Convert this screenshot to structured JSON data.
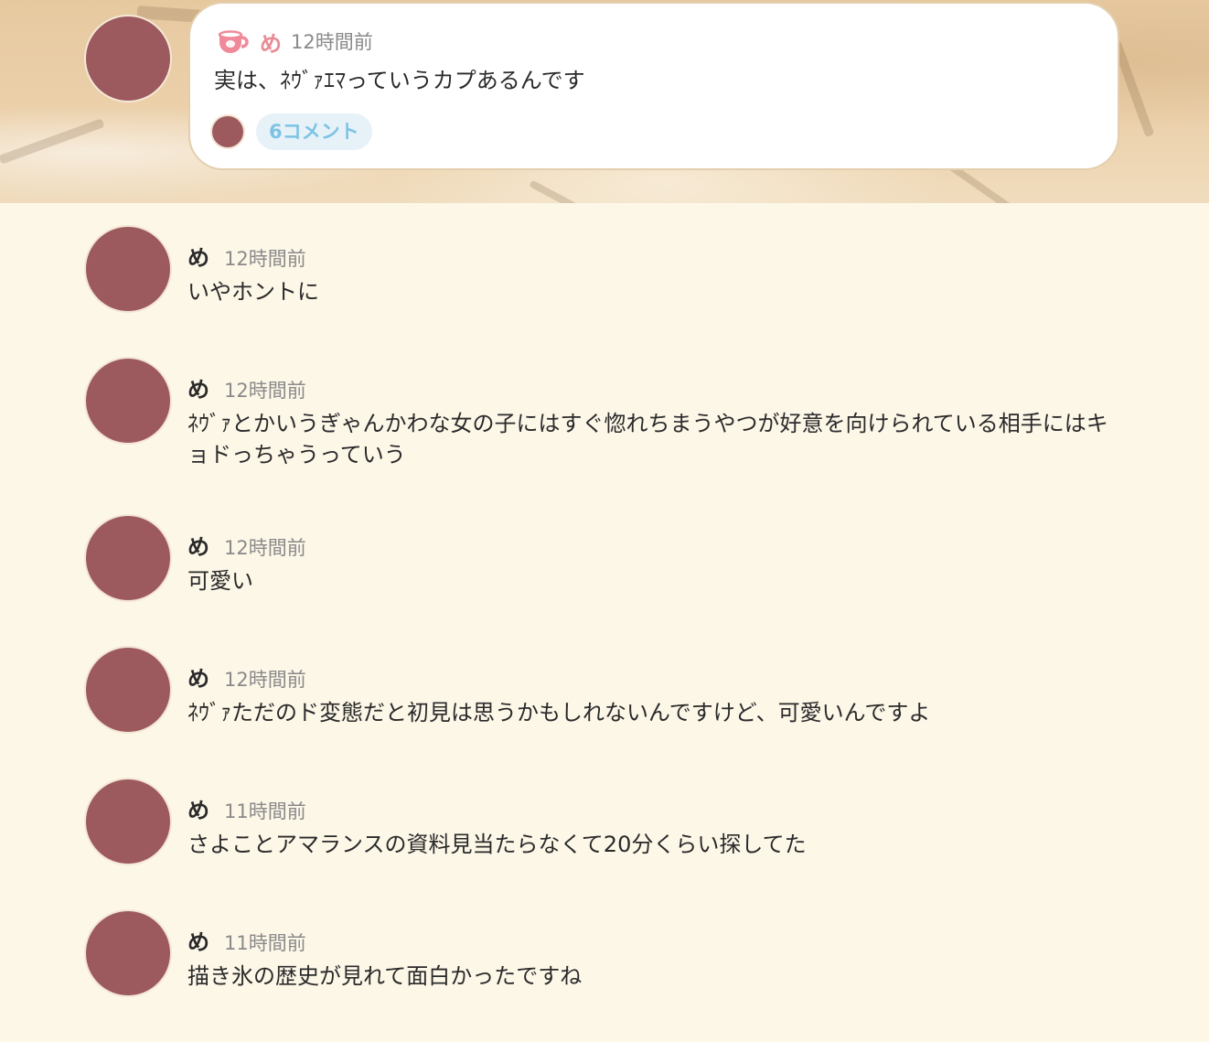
{
  "post": {
    "author": "め",
    "time": "12時間前",
    "text": "実は、ﾈｳﾞｧｴﾏっていうカプあるんです",
    "comment_count_label": "6コメント",
    "icon": "teacup-icon"
  },
  "comments": [
    {
      "author": "め",
      "time": "12時間前",
      "text": "いやホントに"
    },
    {
      "author": "め",
      "time": "12時間前",
      "text": "ﾈｳﾞｧとかいうぎゃんかわな女の子にはすぐ惚れちまうやつが好意を向けられている相手にはキョドっちゃうっていう"
    },
    {
      "author": "め",
      "time": "12時間前",
      "text": "可愛い"
    },
    {
      "author": "め",
      "time": "12時間前",
      "text": "ﾈｳﾞｧただのド変態だと初見は思うかもしれないんですけど、可愛いんですよ"
    },
    {
      "author": "め",
      "time": "11時間前",
      "text": "さよことアマランスの資料見当たらなくて20分くらい探してた"
    },
    {
      "author": "め",
      "time": "11時間前",
      "text": "描き氷の歴史が見れて面白かったですね"
    }
  ],
  "colors": {
    "background": "#fdf7e8",
    "avatar": "#9c5a5f",
    "author_accent": "#e98b94",
    "comment_pill_text": "#7ec3e4",
    "comment_pill_bg": "#e6f2f8"
  }
}
